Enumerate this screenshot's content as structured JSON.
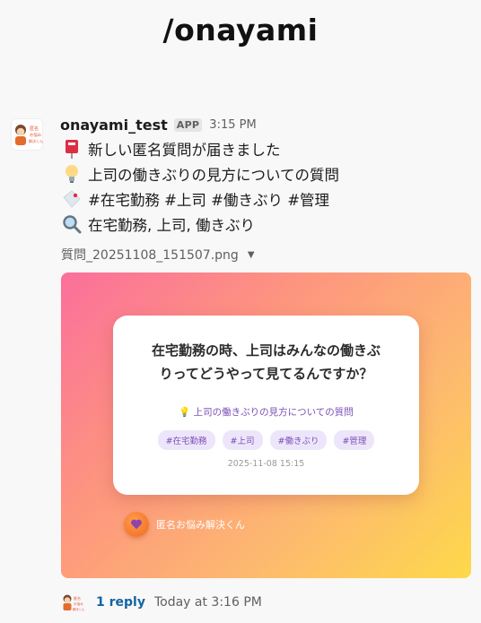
{
  "channel": {
    "title": "/onayami"
  },
  "message": {
    "bot_name": "onayami_test",
    "badge": "APP",
    "time": "3:15 PM",
    "avatar_text": [
      "匿名",
      "お悩み",
      "解決くん"
    ],
    "lines": [
      {
        "icon": "postbox-icon",
        "text": "新しい匿名質問が届きました"
      },
      {
        "icon": "lightbulb-icon",
        "text": "上司の働きぶりの見方についての質問"
      },
      {
        "icon": "tag-icon",
        "text": "#在宅勤務 #上司 #働きぶり #管理"
      },
      {
        "icon": "magnifier-icon",
        "text": "在宅勤務, 上司, 働きぶり"
      }
    ]
  },
  "attachment": {
    "filename": "質問_20251108_151507.png",
    "card": {
      "question_line1": "在宅勤務の時、上司はみんなの働きぶ",
      "question_line2": "りってどうやって見てるんですか？",
      "summary": "💡 上司の働きぶりの見方についての質問",
      "tags": [
        "#在宅勤務",
        "#上司",
        "#働きぶり",
        "#管理"
      ],
      "date": "2025-11-08 15:15",
      "brand": "匿名お悩み解決くん"
    },
    "gradient_colors": [
      "#fb6f9b",
      "#fd957f",
      "#fdb970",
      "#fdd94a"
    ]
  },
  "thread": {
    "reply_count": "1 reply",
    "last_reply": "Today at 3:16 PM"
  }
}
